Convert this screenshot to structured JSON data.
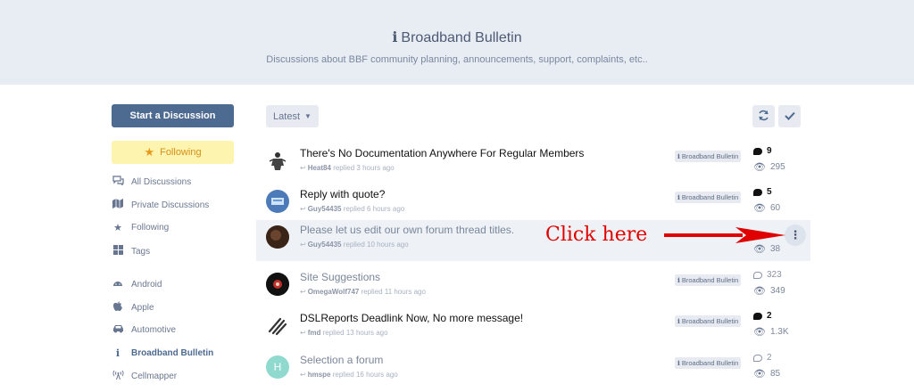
{
  "hero": {
    "icon": "info-icon",
    "title": "Broadband Bulletin",
    "subtitle": "Discussions about BBF community planning, announcements, support, complaints, etc.."
  },
  "sidebar": {
    "start_label": "Start a Discussion",
    "following_label": "Following",
    "nav": [
      {
        "label": "All Discussions",
        "icon": "comments-icon"
      },
      {
        "label": "Private Discussions",
        "icon": "map-icon"
      },
      {
        "label": "Following",
        "icon": "star-icon"
      },
      {
        "label": "Tags",
        "icon": "grid-icon"
      },
      {
        "label": "Android",
        "icon": "android-icon"
      },
      {
        "label": "Apple",
        "icon": "apple-icon"
      },
      {
        "label": "Automotive",
        "icon": "car-icon"
      },
      {
        "label": "Broadband Bulletin",
        "icon": "info-icon"
      },
      {
        "label": "Cellmapper",
        "icon": "antenna-icon"
      }
    ]
  },
  "toolbar": {
    "sort_label": "Latest"
  },
  "discussions": [
    {
      "title": "There's No Documentation Anywhere For Regular Members",
      "user": "Heat84",
      "action": "replied 3 hours ago",
      "tag": "Broadband Bulletin",
      "replies": "9",
      "views": "295"
    },
    {
      "title": "Reply with quote?",
      "user": "Guy54435",
      "action": "replied 6 hours ago",
      "tag": "Broadband Bulletin",
      "replies": "5",
      "views": "60"
    },
    {
      "title": "Please let us edit our own forum thread titles.",
      "user": "Guy54435",
      "action": "replied 10 hours ago",
      "views": "38"
    },
    {
      "title": "Site Suggestions",
      "user": "OmegaWolf747",
      "action": "replied 11 hours ago",
      "tag": "Broadband Bulletin",
      "replies": "323",
      "views": "349"
    },
    {
      "title": "DSLReports Deadlink Now, No more message!",
      "user": "fmd",
      "action": "replied 13 hours ago",
      "tag": "Broadband Bulletin",
      "replies": "2",
      "views": "1.3K"
    },
    {
      "title": "Selection a forum",
      "user": "hmspe",
      "action": "replied 16 hours ago",
      "tag": "Broadband Bulletin",
      "replies": "2",
      "views": "85",
      "avatar_letter": "H"
    }
  ],
  "annotation": {
    "text": "Click here",
    "color": "#e00000"
  },
  "colors": {
    "accent": "#4d6a91",
    "following_bg": "#fdf4b0",
    "hero_bg": "#e8ecf3"
  }
}
